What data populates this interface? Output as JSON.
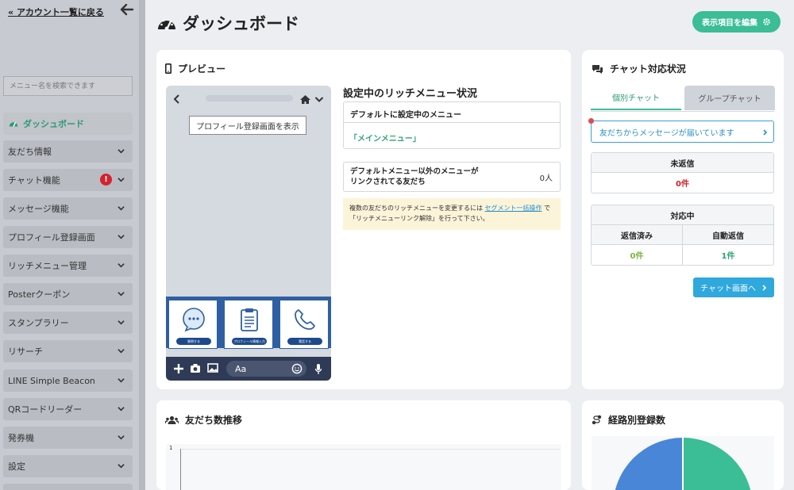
{
  "sidebar": {
    "back_label": "アカウント一覧に戻る",
    "search_placeholder": "メニュー名を検索できます",
    "items": [
      {
        "label": "ダッシュボード",
        "active": true
      },
      {
        "label": "友だち情報"
      },
      {
        "label": "チャット機能",
        "badge": "!"
      },
      {
        "label": "メッセージ機能"
      },
      {
        "label": "プロフィール登録画面"
      },
      {
        "label": "リッチメニュー管理"
      },
      {
        "label": "Posterクーポン"
      },
      {
        "label": "スタンプラリー"
      },
      {
        "label": "リサーチ"
      },
      {
        "label": "LINE Simple Beacon"
      },
      {
        "label": "QRコードリーダー"
      },
      {
        "label": "発券機"
      },
      {
        "label": "設定"
      }
    ]
  },
  "header": {
    "title": "ダッシュボード",
    "edit_button": "表示項目を編集"
  },
  "preview": {
    "title": "プレビュー",
    "profile_button": "プロフィール登録画面を表示",
    "tiles": [
      {
        "label": "質問する",
        "icon": "speech-bubble-icon"
      },
      {
        "label": "プロフィール情報入力",
        "icon": "clipboard-icon"
      },
      {
        "label": "電話する",
        "icon": "phone-icon"
      }
    ],
    "input_placeholder": "Aa"
  },
  "rich_menu": {
    "title": "設定中のリッチメニュー状況",
    "default_header": "デフォルトに設定中のメニュー",
    "default_value": "「メインメニュー」",
    "other_label": "デフォルトメニュー以外のメニューが\nリンクされてる友だち",
    "other_value": "0人",
    "notice_pre": "複数の友だちのリッチメニューを変更するには",
    "notice_link": "セグメント一括操作",
    "notice_post": "で「リッチメニューリンク解除」を行って下さい。"
  },
  "chat": {
    "title": "チャット対応状況",
    "tabs": [
      "個別チャット",
      "グループチャット"
    ],
    "message_link": "友だちからメッセージが届いています",
    "unreplied_label": "未返信",
    "unreplied_value": "0件",
    "handling_label": "対応中",
    "replied_label": "返信済み",
    "auto_label": "自動返信",
    "replied_value": "0件",
    "auto_value": "1件",
    "goto_button": "チャット画面へ"
  },
  "friends_trend": {
    "title": "友だち数推移",
    "y_tick": "1"
  },
  "route": {
    "title": "経路別登録数"
  },
  "colors": {
    "accent_green": "#3bbd96",
    "link_blue": "#2fa8dd",
    "alert_red": "#d5232b",
    "pie_blue": "#4a86d8",
    "pie_green": "#3bbd96"
  }
}
